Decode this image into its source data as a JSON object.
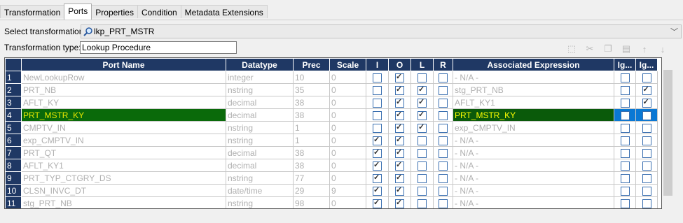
{
  "tabs": [
    {
      "label": "Transformation"
    },
    {
      "label": "Ports"
    },
    {
      "label": "Properties"
    },
    {
      "label": "Condition"
    },
    {
      "label": "Metadata Extensions"
    }
  ],
  "select_transformation": {
    "label": "Select transformation:",
    "value": "lkp_PRT_MSTR"
  },
  "transformation_type": {
    "label": "Transformation type:",
    "value": "Lookup Procedure"
  },
  "toolbar": [
    "new-port-icon",
    "cut-icon",
    "copy-icon",
    "paste-icon",
    "move-up-icon",
    "move-down-icon"
  ],
  "grid": {
    "headers": [
      "Port Name",
      "Datatype",
      "Prec",
      "Scale",
      "I",
      "O",
      "L",
      "R",
      "Associated Expression",
      "Ig...",
      "Ig..."
    ],
    "rows": [
      {
        "n": "1",
        "name": "NewLookupRow",
        "type": "integer",
        "prec": "10",
        "scale": "0",
        "i": false,
        "o": true,
        "l": false,
        "r": false,
        "expr": "- N/A -",
        "ig1": false,
        "ig2": false
      },
      {
        "n": "2",
        "name": "PRT_NB",
        "type": "nstring",
        "prec": "35",
        "scale": "0",
        "i": false,
        "o": true,
        "l": true,
        "r": false,
        "expr": "stg_PRT_NB",
        "ig1": false,
        "ig2": true
      },
      {
        "n": "3",
        "name": "AFLT_KY",
        "type": "decimal",
        "prec": "38",
        "scale": "0",
        "i": false,
        "o": true,
        "l": true,
        "r": false,
        "expr": "AFLT_KY1",
        "ig1": false,
        "ig2": true
      },
      {
        "n": "4",
        "name": "PRT_MSTR_KY",
        "type": "decimal",
        "prec": "38",
        "scale": "0",
        "i": false,
        "o": true,
        "l": true,
        "r": false,
        "expr": "PRT_MSTR_KY",
        "ig1": false,
        "ig2": false
      },
      {
        "n": "5",
        "name": "CMPTV_IN",
        "type": "nstring",
        "prec": "1",
        "scale": "0",
        "i": false,
        "o": true,
        "l": true,
        "r": false,
        "expr": "exp_CMPTV_IN",
        "ig1": false,
        "ig2": false
      },
      {
        "n": "6",
        "name": "exp_CMPTV_IN",
        "type": "nstring",
        "prec": "1",
        "scale": "0",
        "i": true,
        "o": true,
        "l": false,
        "r": false,
        "expr": "- N/A -",
        "ig1": false,
        "ig2": false
      },
      {
        "n": "7",
        "name": "PRT_QT",
        "type": "decimal",
        "prec": "38",
        "scale": "0",
        "i": true,
        "o": true,
        "l": false,
        "r": false,
        "expr": "- N/A -",
        "ig1": false,
        "ig2": false
      },
      {
        "n": "8",
        "name": "AFLT_KY1",
        "type": "decimal",
        "prec": "38",
        "scale": "0",
        "i": true,
        "o": true,
        "l": false,
        "r": false,
        "expr": "- N/A -",
        "ig1": false,
        "ig2": false
      },
      {
        "n": "9",
        "name": "PRT_TYP_CTGRY_DS",
        "type": "nstring",
        "prec": "77",
        "scale": "0",
        "i": true,
        "o": true,
        "l": false,
        "r": false,
        "expr": "- N/A -",
        "ig1": false,
        "ig2": false
      },
      {
        "n": "10",
        "name": "CLSN_INVC_DT",
        "type": "date/time",
        "prec": "29",
        "scale": "9",
        "i": true,
        "o": true,
        "l": false,
        "r": false,
        "expr": "- N/A -",
        "ig1": false,
        "ig2": false
      },
      {
        "n": "11",
        "name": "stg_PRT_NB",
        "type": "nstring",
        "prec": "98",
        "scale": "0",
        "i": true,
        "o": true,
        "l": false,
        "r": false,
        "expr": "- N/A -",
        "ig1": false,
        "ig2": false
      }
    ]
  },
  "colors": {
    "header": "#1f3864",
    "highlight": "#f0f000",
    "selected": "#0a78d4"
  }
}
